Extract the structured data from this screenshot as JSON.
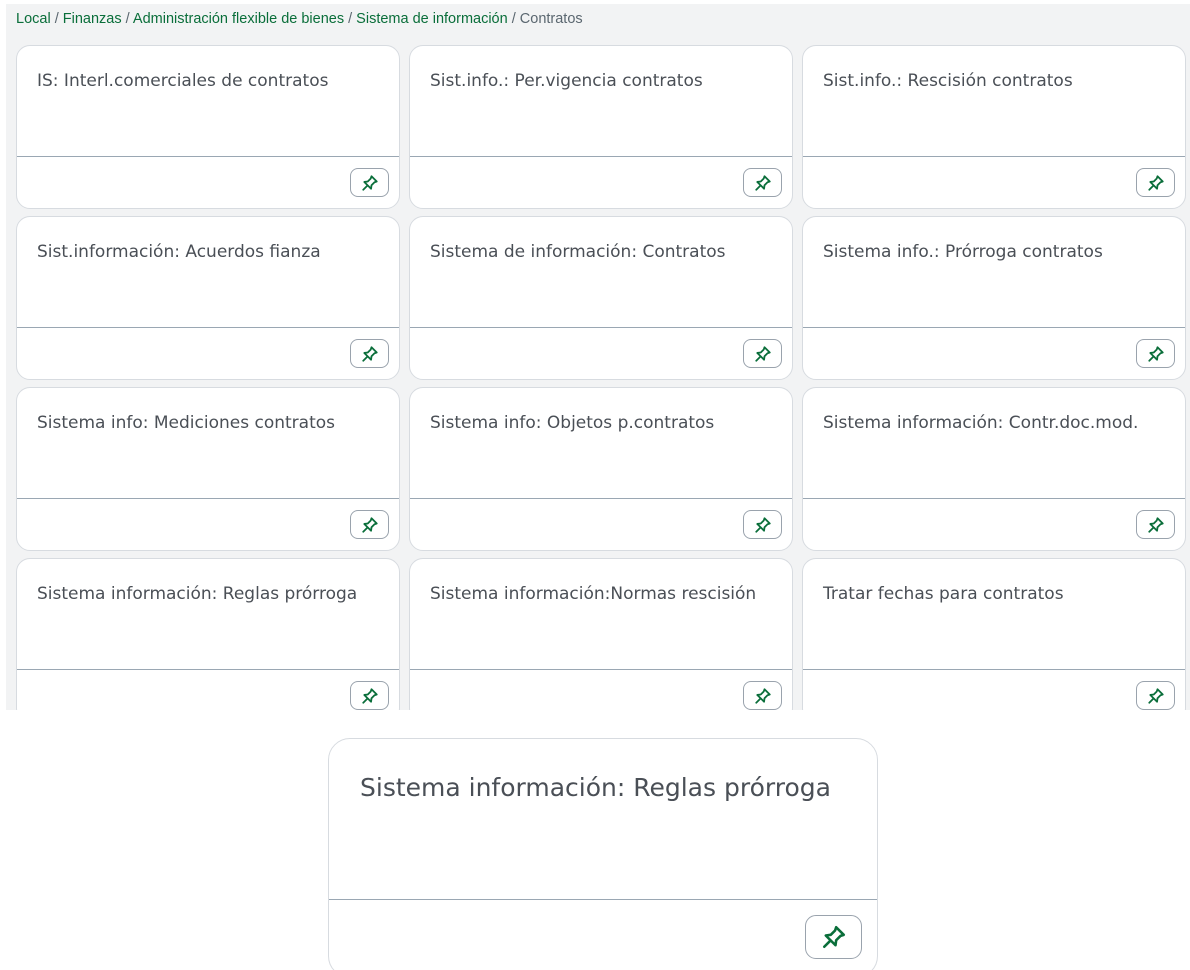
{
  "breadcrumb": {
    "items": [
      {
        "label": "Local",
        "link": true
      },
      {
        "label": "Finanzas",
        "link": true
      },
      {
        "label": "Administración flexible de bienes",
        "link": true
      },
      {
        "label": "Sistema de información",
        "link": true
      },
      {
        "label": "Contratos",
        "link": false
      }
    ],
    "separator": "/"
  },
  "tiles": [
    {
      "title": "IS: Interl.comerciales de contratos"
    },
    {
      "title": "Sist.info.: Per.vigencia contratos"
    },
    {
      "title": "Sist.info.: Rescisión contratos"
    },
    {
      "title": "Sist.información: Acuerdos fianza"
    },
    {
      "title": "Sistema de información: Contratos"
    },
    {
      "title": "Sistema info.: Prórroga contratos"
    },
    {
      "title": "Sistema info: Mediciones contratos"
    },
    {
      "title": "Sistema info: Objetos p.contratos"
    },
    {
      "title": "Sistema información: Contr.doc.mod."
    },
    {
      "title": "Sistema información: Reglas prórroga"
    },
    {
      "title": "Sistema información:Normas rescisión"
    },
    {
      "title": "Tratar fechas para contratos"
    }
  ],
  "zoomed_tile": {
    "title": "Sistema información: Reglas prórroga"
  },
  "icons": {
    "pin": "pin-icon"
  },
  "colors": {
    "link": "#0a6e3a",
    "pin": "#0a6e3a",
    "panel_background": "#f2f3f4",
    "tile_text": "#4a4f56"
  }
}
